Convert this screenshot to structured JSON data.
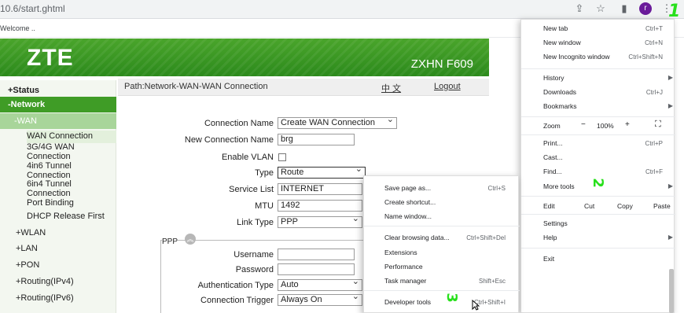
{
  "browser": {
    "url": "10.6/start.ghtml",
    "bookmark_text": "Welcome ..",
    "profile_initial": "r",
    "icons": [
      "share-icon",
      "star-icon",
      "sidebar-icon",
      "profile-icon",
      "kebab-menu-icon"
    ]
  },
  "router": {
    "logo": "ZTE",
    "model": "ZXHN F609",
    "path": "Path:Network-WAN-WAN Connection",
    "lang": "中 文",
    "logout": "Logout"
  },
  "nav": {
    "status": "+Status",
    "network": "-Network",
    "wan": "-WAN",
    "wan_items": [
      "WAN Connection",
      "3G/4G WAN Connection",
      "4in6 Tunnel Connection",
      "6in4 Tunnel Connection",
      "Port Binding",
      "DHCP Release First"
    ],
    "top_items": [
      "+WLAN",
      "+LAN",
      "+PON",
      "+Routing(IPv4)",
      "+Routing(IPv6)"
    ]
  },
  "form": {
    "connection_name_label": "Connection Name",
    "connection_name_value": "Create WAN Connection",
    "new_connection_name_label": "New Connection Name",
    "new_connection_name_value": "brg",
    "enable_vlan_label": "Enable VLAN",
    "type_label": "Type",
    "type_value": "Route",
    "service_list_label": "Service List",
    "service_list_value": "INTERNET",
    "mtu_label": "MTU",
    "mtu_value": "1492",
    "link_type_label": "Link Type",
    "link_type_value": "PPP",
    "ppp_section_label": "PPP",
    "username_label": "Username",
    "username_value": "",
    "password_label": "Password",
    "password_value": "",
    "auth_type_label": "Authentication Type",
    "auth_type_value": "Auto",
    "conn_trigger_label": "Connection Trigger",
    "conn_trigger_value": "Always On"
  },
  "chrome_menu": {
    "new_tab": "New tab",
    "new_tab_sc": "Ctrl+T",
    "new_window": "New window",
    "new_window_sc": "Ctrl+N",
    "incognito": "New Incognito window",
    "incognito_sc": "Ctrl+Shift+N",
    "history": "History",
    "downloads": "Downloads",
    "downloads_sc": "Ctrl+J",
    "bookmarks": "Bookmarks",
    "zoom": "Zoom",
    "zoom_minus": "−",
    "zoom_level": "100%",
    "zoom_plus": "+",
    "print": "Print...",
    "print_sc": "Ctrl+P",
    "cast": "Cast...",
    "find": "Find...",
    "find_sc": "Ctrl+F",
    "more_tools": "More tools",
    "edit": "Edit",
    "cut": "Cut",
    "copy": "Copy",
    "paste": "Paste",
    "settings": "Settings",
    "help": "Help",
    "exit": "Exit"
  },
  "more_tools_menu": {
    "save_page": "Save page as...",
    "save_page_sc": "Ctrl+S",
    "create_shortcut": "Create shortcut...",
    "name_window": "Name window...",
    "clear_data": "Clear browsing data...",
    "clear_data_sc": "Ctrl+Shift+Del",
    "extensions": "Extensions",
    "performance": "Performance",
    "task_manager": "Task manager",
    "task_manager_sc": "Shift+Esc",
    "dev_tools": "Developer tools",
    "dev_tools_sc": "Ctrl+Shift+I"
  },
  "annotations": [
    "1",
    "2",
    "3"
  ],
  "colors": {
    "zte_green": "#3f9c26",
    "annotation_green": "#28e01c"
  }
}
